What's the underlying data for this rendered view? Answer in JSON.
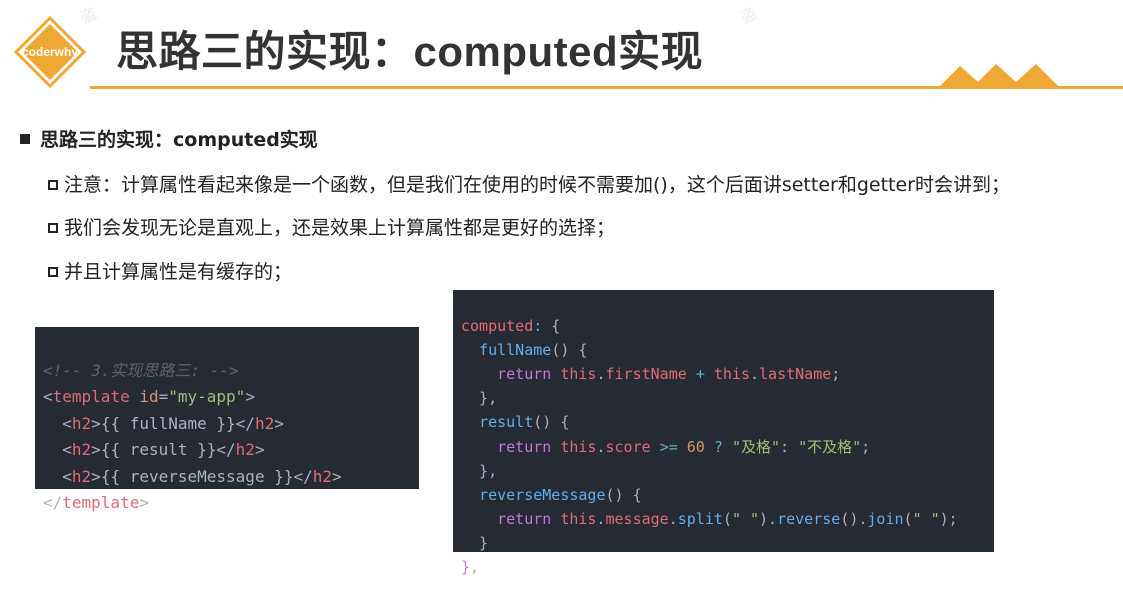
{
  "logo": {
    "text": "coderwhy"
  },
  "header": {
    "title": "思路三的实现：computed实现"
  },
  "content": {
    "main_bullet": "思路三的实现：computed实现",
    "items": [
      "注意：计算属性看起来像是一个函数，但是我们在使用的时候不需要加()，这个后面讲setter和getter时会讲到；",
      "我们会发现无论是直观上，还是效果上计算属性都是更好的选择；",
      "并且计算属性是有缓存的；"
    ]
  },
  "template_code": {
    "comment": "<!-- 3.实现思路三: -->",
    "open_tag": "template",
    "attr_name": "id",
    "attr_value": "\"my-app\"",
    "h2_tag": "h2",
    "mustache_lines": [
      "{{ fullName }}",
      "{{ result }}",
      "{{ reverseMessage }}"
    ],
    "close_tag": "template"
  },
  "script_code": {
    "computed_key": "computed",
    "fullName_fn": "fullName",
    "result_fn": "result",
    "reverse_fn": "reverseMessage",
    "ret": "return",
    "this": "this",
    "firstName": "firstName",
    "lastName": "lastName",
    "score": "score",
    "num60": "60",
    "pass": "\"及格\"",
    "fail": "\"不及格\"",
    "message": "message",
    "split": "split",
    "reverse": "reverse",
    "join": "join",
    "space_str": "\" \""
  },
  "colors": {
    "accent": "#f0a835",
    "code_bg": "#252a33"
  }
}
